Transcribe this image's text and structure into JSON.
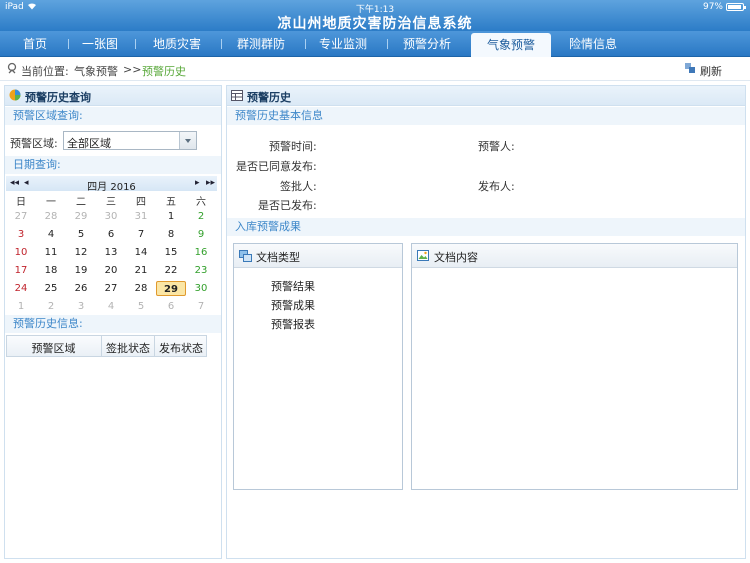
{
  "status": {
    "device": "iPad",
    "time": "下午1:13",
    "battery": "97%"
  },
  "app_title": "凉山州地质灾害防治信息系统",
  "nav": {
    "items": [
      "首页",
      "一张图",
      "地质灾害",
      "群测群防",
      "专业监测",
      "预警分析",
      "气象预警",
      "险情信息"
    ],
    "active_index": 6
  },
  "breadcrumb": {
    "label": "当前位置:",
    "parent": "气象预警",
    "separator": ">>",
    "current": "预警历史",
    "refresh": "刷新"
  },
  "left": {
    "title": "预警历史查询",
    "region_section": "预警区域查询:",
    "region_label": "预警区域:",
    "region_value": "全部区域",
    "date_section": "日期查询:",
    "calendar": {
      "title": "四月 2016",
      "prev_year": "◂◂",
      "prev_month": "◂",
      "next_month": "▸",
      "next_year": "▸▸",
      "weekdays": [
        "日",
        "一",
        "二",
        "三",
        "四",
        "五",
        "六"
      ],
      "weeks": [
        [
          "27",
          "28",
          "29",
          "30",
          "31",
          "1",
          "2"
        ],
        [
          "3",
          "4",
          "5",
          "6",
          "7",
          "8",
          "9"
        ],
        [
          "10",
          "11",
          "12",
          "13",
          "14",
          "15",
          "16"
        ],
        [
          "17",
          "18",
          "19",
          "20",
          "21",
          "22",
          "23"
        ],
        [
          "24",
          "25",
          "26",
          "27",
          "28",
          "29",
          "30"
        ],
        [
          "1",
          "2",
          "3",
          "4",
          "5",
          "6",
          "7"
        ]
      ],
      "selected": "29"
    },
    "history_section": "预警历史信息:",
    "table_columns": [
      "预警区域",
      "签批状态",
      "发布状态"
    ]
  },
  "right": {
    "title": "预警历史",
    "basic_section": "预警历史基本信息",
    "fields": {
      "time": "预警时间:",
      "person": "预警人:",
      "agree_publish": "是否已同意发布:",
      "approver": "签批人:",
      "publisher": "发布人:",
      "published": "是否已发布:"
    },
    "results_section": "入库预警成果",
    "doc_types_title": "文档类型",
    "doc_types": [
      "预警结果",
      "预警成果",
      "预警报表"
    ],
    "doc_content_title": "文档内容"
  },
  "colors": {
    "nav_blue": "#2a78c4",
    "accent_green": "#58a83a",
    "section_blue": "#3d87c9"
  }
}
